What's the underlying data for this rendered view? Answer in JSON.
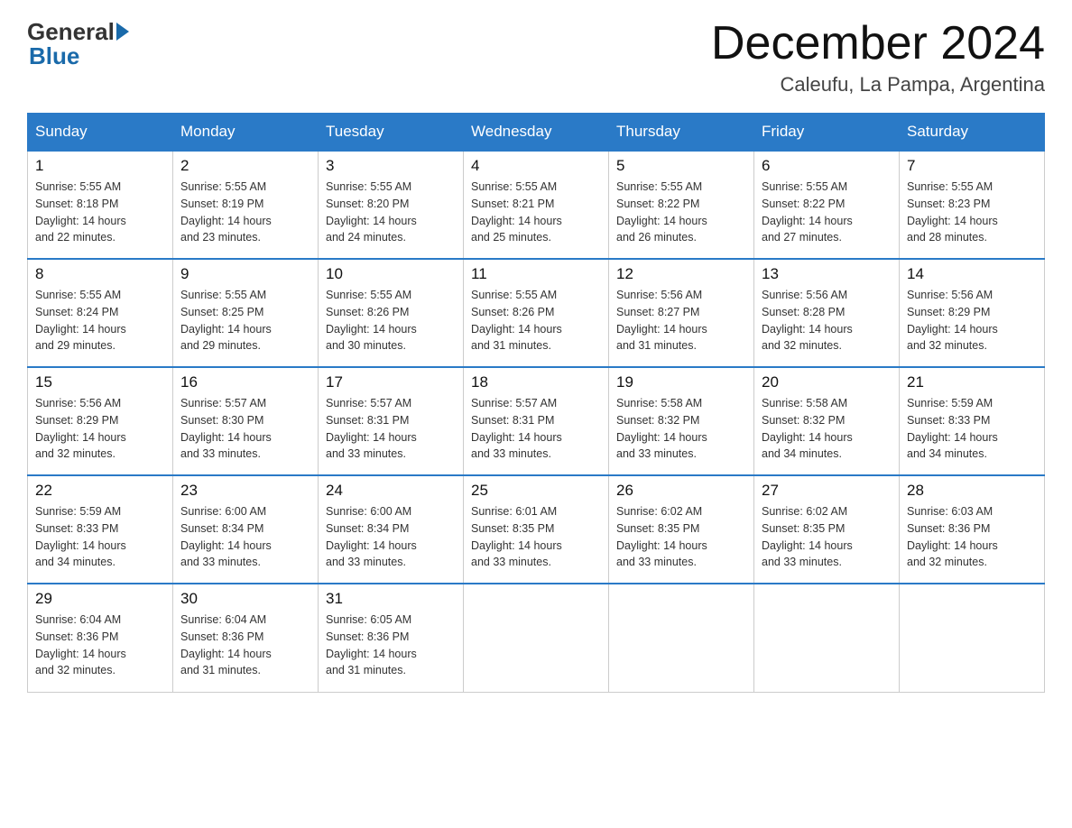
{
  "header": {
    "logo_general": "General",
    "logo_blue": "Blue",
    "month_title": "December 2024",
    "location": "Caleufu, La Pampa, Argentina"
  },
  "days_of_week": [
    "Sunday",
    "Monday",
    "Tuesday",
    "Wednesday",
    "Thursday",
    "Friday",
    "Saturday"
  ],
  "weeks": [
    [
      {
        "day": "1",
        "sunrise": "5:55 AM",
        "sunset": "8:18 PM",
        "daylight": "14 hours and 22 minutes."
      },
      {
        "day": "2",
        "sunrise": "5:55 AM",
        "sunset": "8:19 PM",
        "daylight": "14 hours and 23 minutes."
      },
      {
        "day": "3",
        "sunrise": "5:55 AM",
        "sunset": "8:20 PM",
        "daylight": "14 hours and 24 minutes."
      },
      {
        "day": "4",
        "sunrise": "5:55 AM",
        "sunset": "8:21 PM",
        "daylight": "14 hours and 25 minutes."
      },
      {
        "day": "5",
        "sunrise": "5:55 AM",
        "sunset": "8:22 PM",
        "daylight": "14 hours and 26 minutes."
      },
      {
        "day": "6",
        "sunrise": "5:55 AM",
        "sunset": "8:22 PM",
        "daylight": "14 hours and 27 minutes."
      },
      {
        "day": "7",
        "sunrise": "5:55 AM",
        "sunset": "8:23 PM",
        "daylight": "14 hours and 28 minutes."
      }
    ],
    [
      {
        "day": "8",
        "sunrise": "5:55 AM",
        "sunset": "8:24 PM",
        "daylight": "14 hours and 29 minutes."
      },
      {
        "day": "9",
        "sunrise": "5:55 AM",
        "sunset": "8:25 PM",
        "daylight": "14 hours and 29 minutes."
      },
      {
        "day": "10",
        "sunrise": "5:55 AM",
        "sunset": "8:26 PM",
        "daylight": "14 hours and 30 minutes."
      },
      {
        "day": "11",
        "sunrise": "5:55 AM",
        "sunset": "8:26 PM",
        "daylight": "14 hours and 31 minutes."
      },
      {
        "day": "12",
        "sunrise": "5:56 AM",
        "sunset": "8:27 PM",
        "daylight": "14 hours and 31 minutes."
      },
      {
        "day": "13",
        "sunrise": "5:56 AM",
        "sunset": "8:28 PM",
        "daylight": "14 hours and 32 minutes."
      },
      {
        "day": "14",
        "sunrise": "5:56 AM",
        "sunset": "8:29 PM",
        "daylight": "14 hours and 32 minutes."
      }
    ],
    [
      {
        "day": "15",
        "sunrise": "5:56 AM",
        "sunset": "8:29 PM",
        "daylight": "14 hours and 32 minutes."
      },
      {
        "day": "16",
        "sunrise": "5:57 AM",
        "sunset": "8:30 PM",
        "daylight": "14 hours and 33 minutes."
      },
      {
        "day": "17",
        "sunrise": "5:57 AM",
        "sunset": "8:31 PM",
        "daylight": "14 hours and 33 minutes."
      },
      {
        "day": "18",
        "sunrise": "5:57 AM",
        "sunset": "8:31 PM",
        "daylight": "14 hours and 33 minutes."
      },
      {
        "day": "19",
        "sunrise": "5:58 AM",
        "sunset": "8:32 PM",
        "daylight": "14 hours and 33 minutes."
      },
      {
        "day": "20",
        "sunrise": "5:58 AM",
        "sunset": "8:32 PM",
        "daylight": "14 hours and 34 minutes."
      },
      {
        "day": "21",
        "sunrise": "5:59 AM",
        "sunset": "8:33 PM",
        "daylight": "14 hours and 34 minutes."
      }
    ],
    [
      {
        "day": "22",
        "sunrise": "5:59 AM",
        "sunset": "8:33 PM",
        "daylight": "14 hours and 34 minutes."
      },
      {
        "day": "23",
        "sunrise": "6:00 AM",
        "sunset": "8:34 PM",
        "daylight": "14 hours and 33 minutes."
      },
      {
        "day": "24",
        "sunrise": "6:00 AM",
        "sunset": "8:34 PM",
        "daylight": "14 hours and 33 minutes."
      },
      {
        "day": "25",
        "sunrise": "6:01 AM",
        "sunset": "8:35 PM",
        "daylight": "14 hours and 33 minutes."
      },
      {
        "day": "26",
        "sunrise": "6:02 AM",
        "sunset": "8:35 PM",
        "daylight": "14 hours and 33 minutes."
      },
      {
        "day": "27",
        "sunrise": "6:02 AM",
        "sunset": "8:35 PM",
        "daylight": "14 hours and 33 minutes."
      },
      {
        "day": "28",
        "sunrise": "6:03 AM",
        "sunset": "8:36 PM",
        "daylight": "14 hours and 32 minutes."
      }
    ],
    [
      {
        "day": "29",
        "sunrise": "6:04 AM",
        "sunset": "8:36 PM",
        "daylight": "14 hours and 32 minutes."
      },
      {
        "day": "30",
        "sunrise": "6:04 AM",
        "sunset": "8:36 PM",
        "daylight": "14 hours and 31 minutes."
      },
      {
        "day": "31",
        "sunrise": "6:05 AM",
        "sunset": "8:36 PM",
        "daylight": "14 hours and 31 minutes."
      },
      null,
      null,
      null,
      null
    ]
  ],
  "labels": {
    "sunrise": "Sunrise:",
    "sunset": "Sunset:",
    "daylight": "Daylight:"
  }
}
